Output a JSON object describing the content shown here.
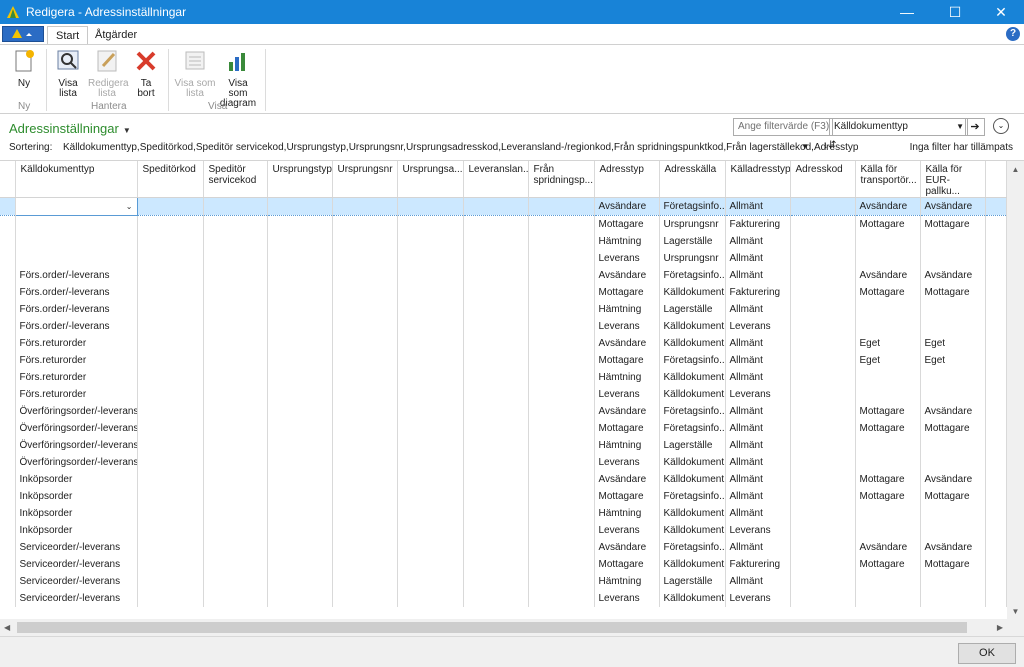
{
  "window": {
    "title": "Redigera - Adressinställningar",
    "minimize": "—",
    "maximize": "☐",
    "close": "✕"
  },
  "ribbon": {
    "tabs": [
      "Start",
      "Åtgärder"
    ],
    "buttons": {
      "new": "Ny",
      "view_list": "Visa lista",
      "edit_list": "Redigera lista",
      "delete": "Ta bort",
      "show_as_list": "Visa som lista",
      "show_as_chart": "Visa som diagram"
    },
    "groups": [
      "Ny",
      "Hantera",
      "Visa"
    ]
  },
  "page": {
    "title": "Adressinställningar",
    "filter_placeholder": "Ange filtervärde (F3)",
    "filter_field": "Källdokumenttyp",
    "sort_label": "Sortering:",
    "sort_value": "Källdokumenttyp,Speditörkod,Speditör servicekod,Ursprungstyp,Ursprungsnr,Ursprungsadresskod,Leveransland-/regionkod,Från spridningspunktkod,Från lagerställekod,Adresstyp",
    "no_filter": "Inga filter har tillämpats"
  },
  "table": {
    "columns": [
      "Källdokumenttyp",
      "Speditörkod",
      "Speditör servicekod",
      "Ursprungstyp",
      "Ursprungsnr",
      "Ursprungsa...",
      "Leveranslan...",
      "Från spridningsp...",
      "Adresstyp",
      "Adresskälla",
      "Källadresstyp",
      "Adresskod",
      "Källa för transportör...",
      "Källa för EUR-pallku..."
    ],
    "rows": [
      [
        "",
        "",
        "",
        "",
        "",
        "",
        "",
        "",
        "Avsändare",
        "Företagsinfo...",
        "Allmänt",
        "",
        "Avsändare",
        "Avsändare"
      ],
      [
        "",
        "",
        "",
        "",
        "",
        "",
        "",
        "",
        "Mottagare",
        "Ursprungsnr",
        "Fakturering",
        "",
        "Mottagare",
        "Mottagare"
      ],
      [
        "",
        "",
        "",
        "",
        "",
        "",
        "",
        "",
        "Hämtning",
        "Lagerställe",
        "Allmänt",
        "",
        "",
        ""
      ],
      [
        "",
        "",
        "",
        "",
        "",
        "",
        "",
        "",
        "Leverans",
        "Ursprungsnr",
        "Allmänt",
        "",
        "",
        ""
      ],
      [
        "Förs.order/-leverans",
        "",
        "",
        "",
        "",
        "",
        "",
        "",
        "Avsändare",
        "Företagsinfo...",
        "Allmänt",
        "",
        "Avsändare",
        "Avsändare"
      ],
      [
        "Förs.order/-leverans",
        "",
        "",
        "",
        "",
        "",
        "",
        "",
        "Mottagare",
        "Källdokument",
        "Fakturering",
        "",
        "Mottagare",
        "Mottagare"
      ],
      [
        "Förs.order/-leverans",
        "",
        "",
        "",
        "",
        "",
        "",
        "",
        "Hämtning",
        "Lagerställe",
        "Allmänt",
        "",
        "",
        ""
      ],
      [
        "Förs.order/-leverans",
        "",
        "",
        "",
        "",
        "",
        "",
        "",
        "Leverans",
        "Källdokument",
        "Leverans",
        "",
        "",
        ""
      ],
      [
        "Förs.returorder",
        "",
        "",
        "",
        "",
        "",
        "",
        "",
        "Avsändare",
        "Källdokument",
        "Allmänt",
        "",
        "Eget",
        "Eget"
      ],
      [
        "Förs.returorder",
        "",
        "",
        "",
        "",
        "",
        "",
        "",
        "Mottagare",
        "Företagsinfo...",
        "Allmänt",
        "",
        "Eget",
        "Eget"
      ],
      [
        "Förs.returorder",
        "",
        "",
        "",
        "",
        "",
        "",
        "",
        "Hämtning",
        "Källdokument",
        "Allmänt",
        "",
        "",
        ""
      ],
      [
        "Förs.returorder",
        "",
        "",
        "",
        "",
        "",
        "",
        "",
        "Leverans",
        "Källdokument",
        "Leverans",
        "",
        "",
        ""
      ],
      [
        "Överföringsorder/-leverans",
        "",
        "",
        "",
        "",
        "",
        "",
        "",
        "Avsändare",
        "Företagsinfo...",
        "Allmänt",
        "",
        "Mottagare",
        "Avsändare"
      ],
      [
        "Överföringsorder/-leverans",
        "",
        "",
        "",
        "",
        "",
        "",
        "",
        "Mottagare",
        "Företagsinfo...",
        "Allmänt",
        "",
        "Mottagare",
        "Mottagare"
      ],
      [
        "Överföringsorder/-leverans",
        "",
        "",
        "",
        "",
        "",
        "",
        "",
        "Hämtning",
        "Lagerställe",
        "Allmänt",
        "",
        "",
        ""
      ],
      [
        "Överföringsorder/-leverans",
        "",
        "",
        "",
        "",
        "",
        "",
        "",
        "Leverans",
        "Källdokument",
        "Allmänt",
        "",
        "",
        ""
      ],
      [
        "Inköpsorder",
        "",
        "",
        "",
        "",
        "",
        "",
        "",
        "Avsändare",
        "Källdokument",
        "Allmänt",
        "",
        "Mottagare",
        "Avsändare"
      ],
      [
        "Inköpsorder",
        "",
        "",
        "",
        "",
        "",
        "",
        "",
        "Mottagare",
        "Företagsinfo...",
        "Allmänt",
        "",
        "Mottagare",
        "Mottagare"
      ],
      [
        "Inköpsorder",
        "",
        "",
        "",
        "",
        "",
        "",
        "",
        "Hämtning",
        "Källdokument",
        "Allmänt",
        "",
        "",
        ""
      ],
      [
        "Inköpsorder",
        "",
        "",
        "",
        "",
        "",
        "",
        "",
        "Leverans",
        "Källdokument",
        "Leverans",
        "",
        "",
        ""
      ],
      [
        "Serviceorder/-leverans",
        "",
        "",
        "",
        "",
        "",
        "",
        "",
        "Avsändare",
        "Företagsinfo...",
        "Allmänt",
        "",
        "Avsändare",
        "Avsändare"
      ],
      [
        "Serviceorder/-leverans",
        "",
        "",
        "",
        "",
        "",
        "",
        "",
        "Mottagare",
        "Källdokument",
        "Fakturering",
        "",
        "Mottagare",
        "Mottagare"
      ],
      [
        "Serviceorder/-leverans",
        "",
        "",
        "",
        "",
        "",
        "",
        "",
        "Hämtning",
        "Lagerställe",
        "Allmänt",
        "",
        "",
        ""
      ],
      [
        "Serviceorder/-leverans",
        "",
        "",
        "",
        "",
        "",
        "",
        "",
        "Leverans",
        "Källdokument",
        "Leverans",
        "",
        "",
        ""
      ]
    ]
  },
  "footer": {
    "ok": "OK"
  },
  "colors": {
    "titlebar": "#1883d7",
    "page_title": "#2d8c2d",
    "selected_row": "#cce8ff"
  }
}
